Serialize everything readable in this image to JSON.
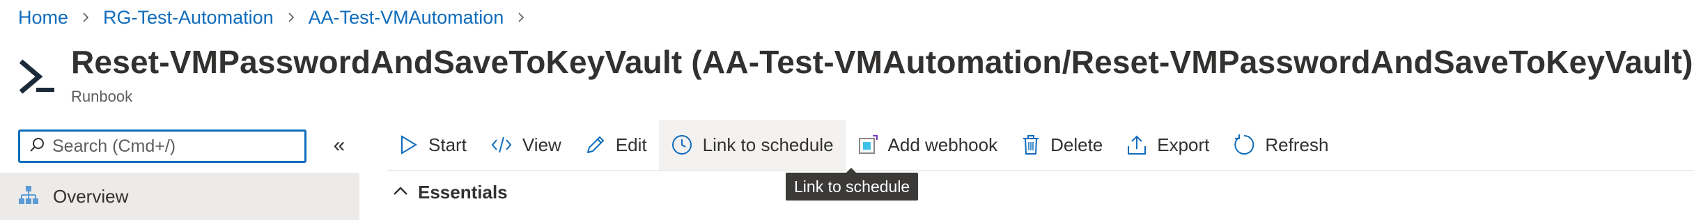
{
  "breadcrumb": {
    "items": [
      {
        "label": "Home"
      },
      {
        "label": "RG-Test-Automation"
      },
      {
        "label": "AA-Test-VMAutomation"
      }
    ]
  },
  "header": {
    "title": "Reset-VMPasswordAndSaveToKeyVault (AA-Test-VMAutomation/Reset-VMPasswordAndSaveToKeyVault)",
    "subtitle": "Runbook",
    "icon": "powershell-runbook-icon"
  },
  "sidebar": {
    "search": {
      "placeholder": "Search (Cmd+/)",
      "value": ""
    },
    "collapse_label": "«",
    "items": [
      {
        "label": "Overview",
        "icon": "overview-hierarchy-icon",
        "selected": true
      }
    ]
  },
  "toolbar": {
    "buttons": [
      {
        "label": "Start",
        "icon": "play-icon"
      },
      {
        "label": "View",
        "icon": "code-icon"
      },
      {
        "label": "Edit",
        "icon": "pencil-icon"
      },
      {
        "label": "Link to schedule",
        "icon": "clock-icon",
        "hovered": true
      },
      {
        "label": "Add webhook",
        "icon": "webhook-icon"
      },
      {
        "label": "Delete",
        "icon": "trash-icon"
      },
      {
        "label": "Export",
        "icon": "export-icon"
      },
      {
        "label": "Refresh",
        "icon": "refresh-icon"
      }
    ]
  },
  "essentials": {
    "label": "Essentials",
    "expanded": true
  },
  "tooltip": {
    "text": "Link to schedule"
  },
  "colors": {
    "accent": "#0f6cbd",
    "text": "#323130",
    "hover_bg": "#f3f2f1",
    "selected_bg": "#edebe9",
    "tooltip_bg": "#3b3a39"
  }
}
